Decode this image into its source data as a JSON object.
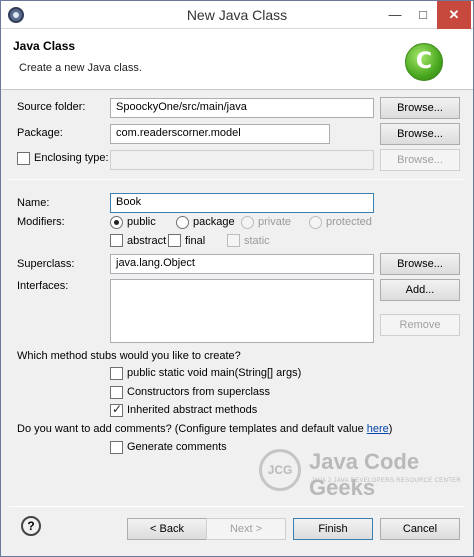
{
  "window": {
    "title": "New Java Class",
    "minimize": "—",
    "maximize": "□",
    "close": "✕"
  },
  "banner": {
    "title": "Java Class",
    "description": "Create a new Java class.",
    "logo_icon": "java-class-logo-icon",
    "logo_glyph": "C"
  },
  "form": {
    "source_folder": {
      "label": "Source folder:",
      "value": "SpoockyOne/src/main/java",
      "button": "Browse..."
    },
    "package": {
      "label": "Package:",
      "value": "com.readerscorner.model",
      "button": "Browse..."
    },
    "enclosing_type": {
      "label": "Enclosing type:",
      "value": "",
      "button": "Browse..."
    },
    "name": {
      "label": "Name:",
      "value": "Book"
    },
    "modifiers": {
      "label": "Modifiers:",
      "public": "public",
      "package": "package",
      "private": "private",
      "protected": "protected",
      "abstract": "abstract",
      "final": "final",
      "static": "static"
    },
    "superclass": {
      "label": "Superclass:",
      "value": "java.lang.Object",
      "button": "Browse..."
    },
    "interfaces": {
      "label": "Interfaces:",
      "add_button": "Add...",
      "remove_button": "Remove"
    },
    "stubs": {
      "question": "Which method stubs would you like to create?",
      "main": "public static void main(String[] args)",
      "constructors": "Constructors from superclass",
      "inherited": "Inherited abstract methods"
    },
    "comments": {
      "question_prefix": "Do you want to add comments? (Configure templates and default value ",
      "link": "here",
      "question_suffix": ")",
      "generate": "Generate comments"
    }
  },
  "watermark": {
    "circle_text": "JCG",
    "name": "Java Code Geeks",
    "tagline": "JAVA 2 JAVA DEVELOPERS RESOURCE CENTER"
  },
  "footer": {
    "help_glyph": "?",
    "back": "< Back",
    "next": "Next >",
    "finish": "Finish",
    "cancel": "Cancel"
  },
  "colors": {
    "accent": "#3c7fb1",
    "close_button": "#c7483d",
    "link": "#0645ad"
  }
}
